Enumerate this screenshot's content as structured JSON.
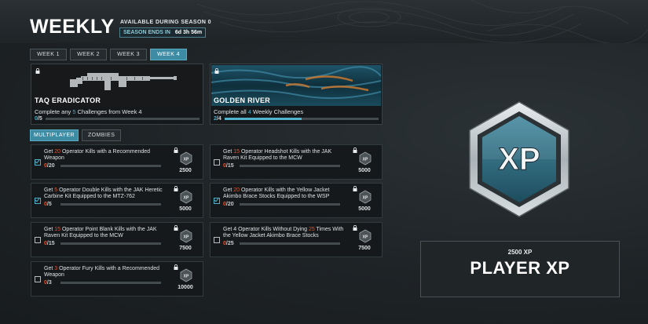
{
  "header": {
    "title": "WEEKLY",
    "availability": "AVAILABLE DURING SEASON 0",
    "season_label": "SEASON ENDS IN",
    "season_time": "6d 3h 56m"
  },
  "week_tabs": [
    {
      "label": "WEEK 1",
      "active": false
    },
    {
      "label": "WEEK 2",
      "active": false
    },
    {
      "label": "WEEK 3",
      "active": false
    },
    {
      "label": "WEEK 4",
      "active": true
    }
  ],
  "rewards": [
    {
      "name": "TAQ ERADICATOR",
      "desc_pre": "Complete any ",
      "desc_num": "5",
      "desc_post": " Challenges from Week 4",
      "progress_cur": "0",
      "progress_total": "/5",
      "progress": 0.0
    },
    {
      "name": "GOLDEN RIVER",
      "desc_pre": "Complete all ",
      "desc_num": "4",
      "desc_post": " Weekly Challenges",
      "progress_cur": "2",
      "progress_total": "/4",
      "progress": 0.5
    }
  ],
  "mode_tabs": [
    {
      "label": "MULTIPLAYER",
      "active": true
    },
    {
      "label": "ZOMBIES",
      "active": false
    }
  ],
  "challenges": [
    {
      "pre": "Get ",
      "num": "20",
      "post": " Operator Kills with a Recommended Weapon",
      "cur": "0",
      "total": "/20",
      "xp": "2500",
      "checked": true
    },
    {
      "pre": "Get ",
      "num": "15",
      "post": " Operator Headshot Kills with the JAK Raven Kit Equipped to the MCW",
      "cur": "0",
      "total": "/15",
      "xp": "5000",
      "checked": false
    },
    {
      "pre": "Get ",
      "num": "5",
      "post": " Operator Double Kills with the JAK Heretic Carbine Kit Equipped to the MTZ-762",
      "cur": "0",
      "total": "/5",
      "xp": "5000",
      "checked": true
    },
    {
      "pre": "Get ",
      "num": "20",
      "post": " Operator Kills with the Yellow Jacket Akimbo Brace Stocks Equipped to the WSP",
      "cur": "0",
      "total": "/20",
      "xp": "5000",
      "checked": true
    },
    {
      "pre": "Get ",
      "num": "15",
      "post": " Operator Point Blank Kills with the JAK Raven Kit Equipped to the MCW",
      "cur": "0",
      "total": "/15",
      "xp": "7500",
      "checked": false
    },
    {
      "pre": "Get 4 Operator Kills Without Dying ",
      "num": "25",
      "post": " Times With the Yellow Jacket Akimbo Brace Stocks",
      "cur": "0",
      "total": "/25",
      "xp": "7500",
      "checked": false
    },
    {
      "pre": "Get ",
      "num": "3",
      "post": " Operator Fury Kills with a Recommended Weapon",
      "cur": "0",
      "total": "/3",
      "xp": "10000",
      "checked": false
    }
  ],
  "reward_panel": {
    "amount": "2500 XP",
    "label": "PLAYER XP",
    "icon_text": "XP"
  },
  "colors": {
    "accent": "#3d8ca3",
    "highlight": "#e0532f",
    "progress": "#52b3cc"
  }
}
